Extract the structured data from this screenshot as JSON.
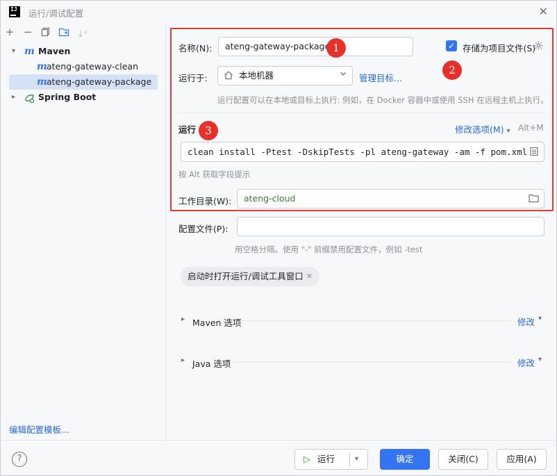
{
  "window": {
    "title": "运行/调试配置",
    "app_icon_text": "IJ"
  },
  "left": {
    "tree": [
      {
        "label": "Maven",
        "level": 0,
        "expanded": true
      },
      {
        "label": "ateng-gateway-clean",
        "level": 1
      },
      {
        "label": "ateng-gateway-package",
        "level": 1,
        "selected": true
      },
      {
        "label": "Spring Boot",
        "level": 0,
        "expanded": false
      }
    ],
    "edit_templates_link": "编辑配置模板..."
  },
  "form": {
    "name_label": "名称(N):",
    "name_value": "ateng-gateway-package",
    "store_as_file_label": "存储为项目文件(S)",
    "store_as_file_checked": true,
    "run_on_label": "运行于:",
    "run_on_value": "本地机器",
    "manage_targets_link": "管理目标...",
    "run_on_hint": "运行配置可以在本地或目标上执行: 例如，在 Docker 容器中或使用 SSH 在远程主机上执行。",
    "run_section_title": "运行",
    "modify_options_link": "修改选项(M)",
    "modify_options_shortcut": "Alt+M",
    "command_value": "clean install -Ptest -DskipTests -pl ateng-gateway -am -f pom.xml",
    "alt_hint": "按 Alt 获取字段提示",
    "workdir_label": "工作目录(W):",
    "workdir_value": "ateng-cloud",
    "profiles_label": "配置文件(P):",
    "profiles_value": "",
    "profiles_hint": "用空格分隔。使用 \"-\" 前缀禁用配置文件，例如 -test",
    "chip_label": "启动时打开运行/调试工具窗口",
    "maven_options_label": "Maven 选项",
    "java_options_label": "Java 选项",
    "modify_label": "修改"
  },
  "annotations": {
    "badge1": "1",
    "badge2": "2",
    "badge3": "3"
  },
  "buttons": {
    "help": "?",
    "run": "运行",
    "ok": "确定",
    "close": "关闭(C)",
    "apply": "应用(A)"
  },
  "colors": {
    "accent": "#3574f0",
    "annotation_red": "#e53935",
    "link": "#2a67d6"
  },
  "icons": {
    "home": "home-icon",
    "folder": "folder-icon",
    "gear": "gear-icon",
    "expand_field": "expand-field-icon"
  }
}
